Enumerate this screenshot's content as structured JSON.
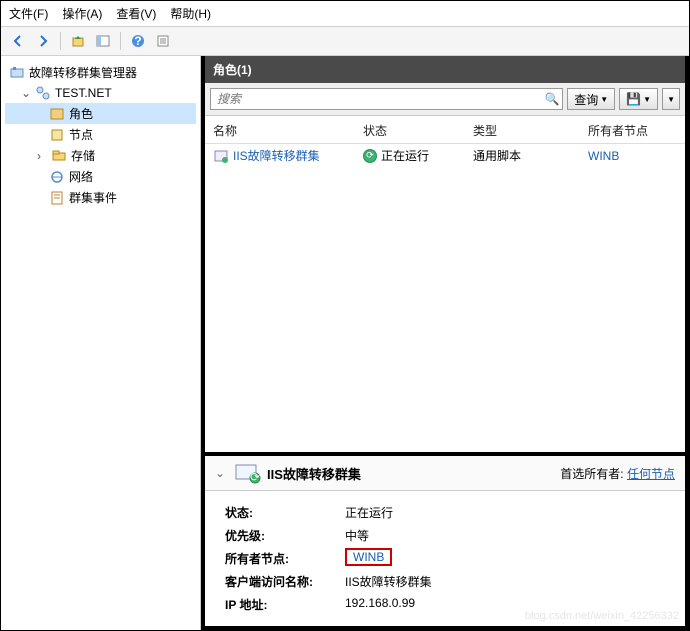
{
  "menu": {
    "file": "文件(F)",
    "action": "操作(A)",
    "view": "查看(V)",
    "help": "帮助(H)"
  },
  "toolbar_icons": {
    "back": "back-icon",
    "forward": "forward-icon",
    "up": "up-icon",
    "refresh": "refresh-icon",
    "help": "help-icon",
    "props": "properties-icon"
  },
  "tree": {
    "root": "故障转移群集管理器",
    "cluster": "TEST.NET",
    "roles": "角色",
    "nodes": "节点",
    "storage": "存储",
    "networks": "网络",
    "events": "群集事件"
  },
  "panel": {
    "title": "角色(1)",
    "search_placeholder": "搜索",
    "query_btn": "查询",
    "columns": {
      "name": "名称",
      "status": "状态",
      "type": "类型",
      "owner": "所有者节点"
    },
    "rows": [
      {
        "name": "IIS故障转移群集",
        "status": "正在运行",
        "type": "通用脚本",
        "owner": "WINB"
      }
    ]
  },
  "detail": {
    "title": "IIS故障转移群集",
    "pref_owner_label": "首选所有者:",
    "pref_owner_link": "任何节点",
    "labels": {
      "status": "状态:",
      "priority": "优先级:",
      "owner": "所有者节点:",
      "client": "客户端访问名称:",
      "ip": "IP 地址:"
    },
    "values": {
      "status": "正在运行",
      "priority": "中等",
      "owner": "WINB",
      "client": "IIS故障转移群集",
      "ip": "192.168.0.99"
    }
  },
  "watermark": "blog.csdn.net/weixin_42256332"
}
